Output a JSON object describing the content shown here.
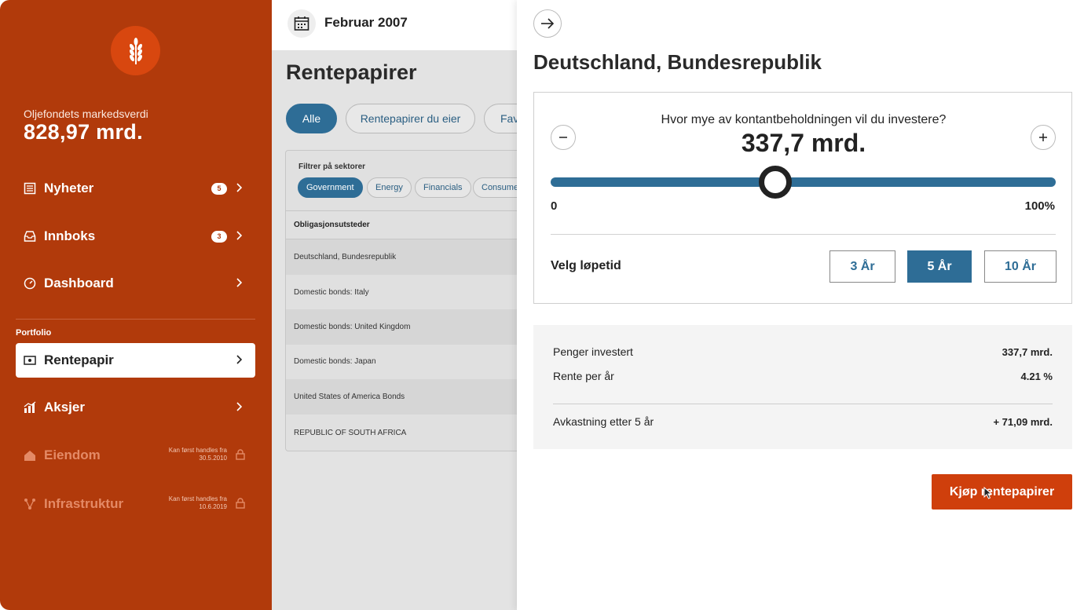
{
  "sidebar": {
    "market_value_label": "Oljefondets markedsverdi",
    "market_value": "828,97 mrd.",
    "portfolio_label": "Portfolio",
    "items": [
      {
        "label": "Nyheter",
        "badge": "5"
      },
      {
        "label": "Innboks",
        "badge": "3"
      },
      {
        "label": "Dashboard"
      },
      {
        "label": "Rentepapir"
      },
      {
        "label": "Aksjer"
      },
      {
        "label": "Eiendom",
        "note_line1": "Kan først handles fra",
        "note_line2": "30.5.2010"
      },
      {
        "label": "Infrastruktur",
        "note_line1": "Kan først handles fra",
        "note_line2": "10.6.2019"
      }
    ]
  },
  "middle": {
    "date": "Februar 2007",
    "title": "Rentepapirer",
    "tabs": [
      "Alle",
      "Rentepapirer du eier",
      "Fav"
    ],
    "filter_label": "Filtrer på sektorer",
    "sectors": [
      "Government",
      "Energy",
      "Financials",
      "Consume"
    ],
    "table_header": "Obligasjonsutsteder",
    "rows": [
      "Deutschland, Bundesrepublik",
      "Domestic bonds: Italy",
      "Domestic bonds: United Kingdom",
      "Domestic bonds: Japan",
      "United States of America Bonds",
      "REPUBLIC OF SOUTH AFRICA"
    ]
  },
  "detail": {
    "title": "Deutschland, Bundesrepublik",
    "question": "Hvor mye av kontantbeholdningen vil du investere?",
    "amount": "337,7 mrd.",
    "slider_min": "0",
    "slider_max": "100%",
    "slider_fraction": 0.445,
    "term_label": "Velg løpetid",
    "terms": [
      "3 År",
      "5 År",
      "10 År"
    ],
    "selected_term": "5 År",
    "summary": {
      "invested_label": "Penger investert",
      "invested_value": "337,7 mrd.",
      "rate_label": "Rente per år",
      "rate_value": "4.21 %",
      "return_label": "Avkastning etter 5 år",
      "return_value": "+ 71,09 mrd."
    },
    "buy_label": "Kjøp rentepapirer"
  },
  "colors": {
    "sidebar_bg": "#b13a0b",
    "accent_blue": "#2e6d96",
    "buy_button": "#cf3f0c"
  }
}
